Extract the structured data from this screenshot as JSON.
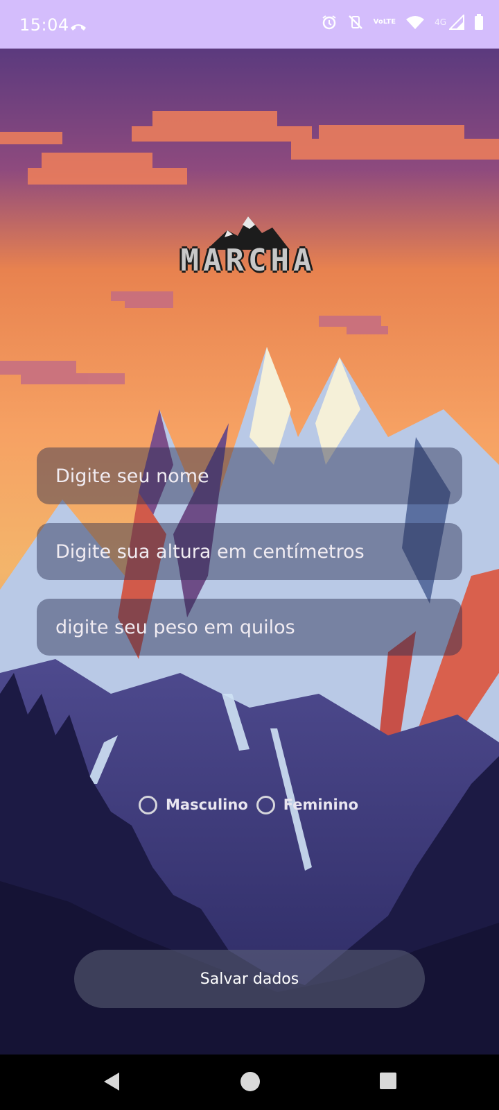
{
  "status_bar": {
    "time": "15:04",
    "icons": [
      "call-icon",
      "alarm-icon",
      "vibrate-off-icon",
      "volte-icon",
      "wifi-icon",
      "signal-icon",
      "battery-icon"
    ],
    "volte_top": "Vo",
    "volte_bottom": "LTE",
    "network": "4G"
  },
  "logo": {
    "text": "MARCHA"
  },
  "form": {
    "name_placeholder": "Digite seu nome",
    "height_placeholder": "Digite sua altura em centímetros",
    "weight_placeholder": "digite seu peso em quilos",
    "gender_options": [
      "Masculino",
      "Feminino"
    ],
    "save_label": "Salvar dados"
  },
  "nav_bar": {
    "icons": [
      "back-icon",
      "home-icon",
      "recents-icon"
    ]
  }
}
